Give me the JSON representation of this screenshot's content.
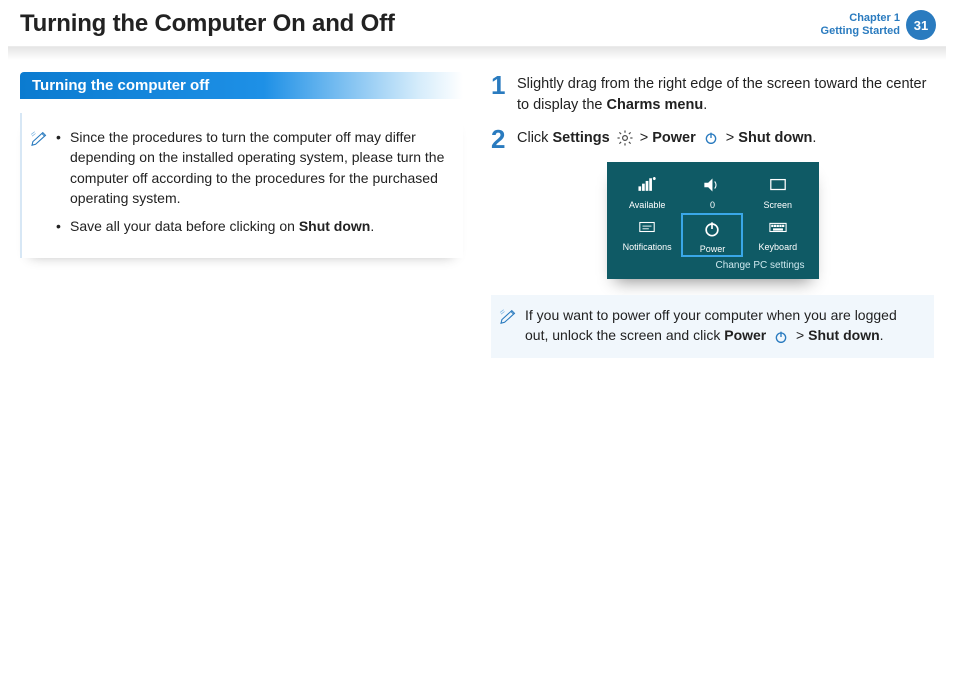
{
  "header": {
    "title": "Turning the Computer On and Off",
    "chapter_line1": "Chapter 1",
    "chapter_line2": "Getting Started",
    "page_number": "31"
  },
  "section": {
    "tab_label": "Turning the computer off"
  },
  "notes": {
    "item1_a": "Since the procedures to turn the computer off may differ depending on the installed operating system, please turn the computer off according to the procedures for the purchased operating system.",
    "item2_a": "Save all your data before clicking on ",
    "item2_b": "Shut down",
    "item2_c": "."
  },
  "steps": {
    "s1_num": "1",
    "s1_a": "Slightly drag from the right edge of the screen toward the center to display the ",
    "s1_b": "Charms menu",
    "s1_c": ".",
    "s2_num": "2",
    "s2_a": "Click ",
    "s2_b": "Settings",
    "s2_c": " > ",
    "s2_d": "Power",
    "s2_e": " > ",
    "s2_f": "Shut down",
    "s2_g": "."
  },
  "charms": {
    "available": "Available",
    "zero": "0",
    "screen": "Screen",
    "notifications": "Notifications",
    "power": "Power",
    "keyboard": "Keyboard",
    "link": "Change PC settings"
  },
  "tip": {
    "a": "If you want to power off your computer when you are logged out, unlock the screen and click ",
    "b": "Power",
    "c": " > ",
    "d": "Shut down",
    "e": "."
  }
}
